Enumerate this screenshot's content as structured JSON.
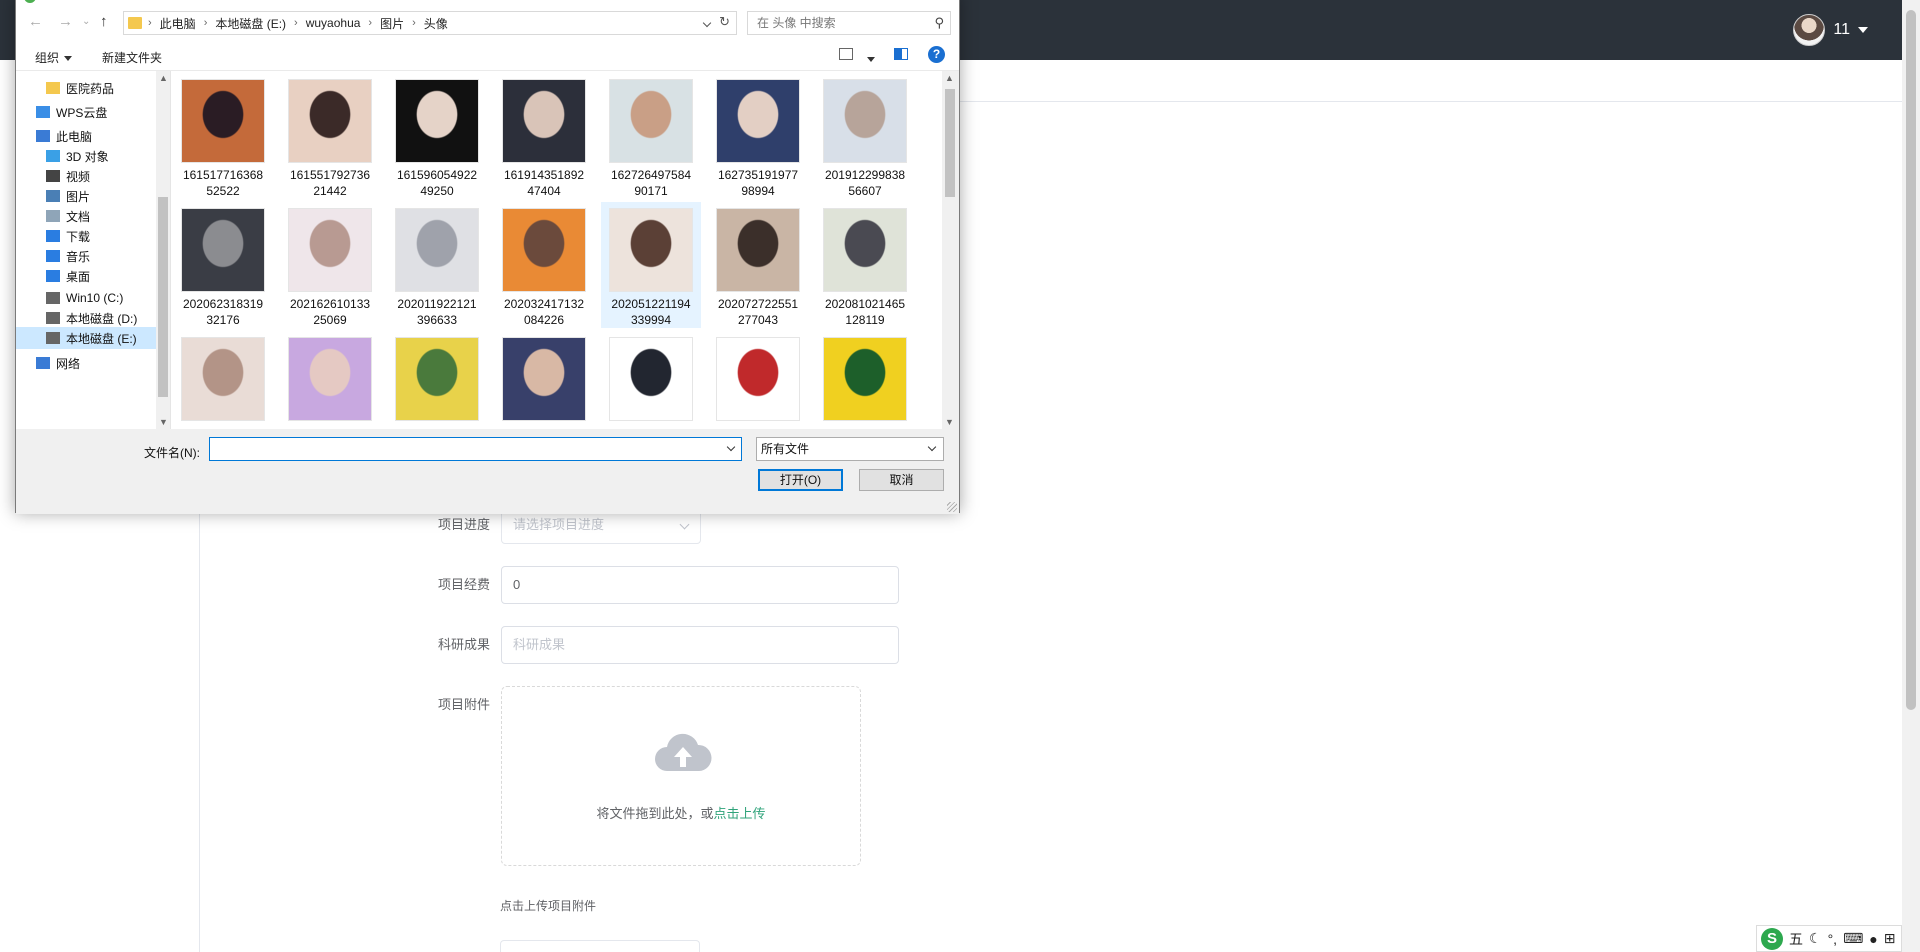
{
  "app": {
    "username": "11"
  },
  "form": {
    "progress_label": "项目进度",
    "progress_placeholder": "请选择项目进度",
    "funding_label": "项目经费",
    "funding_value": "0",
    "results_label": "科研成果",
    "results_placeholder": "科研成果",
    "attachment_label": "项目附件",
    "upload_text": "将文件拖到此处，或",
    "upload_link": "点击上传",
    "upload_tip": "点击上传项目附件"
  },
  "ime": {
    "logo": "S",
    "mode": "五",
    "icons": [
      "moon-icon",
      "punctuation-icon",
      "keyboard-icon",
      "user-icon",
      "grid-icon"
    ]
  },
  "dialog": {
    "breadcrumb": [
      "此电脑",
      "本地磁盘 (E:)",
      "wuyaohua",
      "图片",
      "头像"
    ],
    "search_placeholder": "在 头像 中搜索",
    "organize_label": "组织",
    "new_folder_label": "新建文件夹",
    "help_label": "?",
    "nav_items": [
      {
        "label": "医院药品",
        "icon": "folder-icon",
        "color": "#f4c84e"
      },
      {
        "label": "WPS云盘",
        "icon": "cloud-icon",
        "color": "#3a8ee6"
      },
      {
        "label": "此电脑",
        "icon": "computer-icon",
        "color": "#3a7bd5"
      },
      {
        "label": "3D 对象",
        "icon": "cube-icon",
        "color": "#3aa0e6"
      },
      {
        "label": "视频",
        "icon": "video-icon",
        "color": "#444444"
      },
      {
        "label": "图片",
        "icon": "picture-icon",
        "color": "#4a7fb5"
      },
      {
        "label": "文档",
        "icon": "document-icon",
        "color": "#8fa5b8"
      },
      {
        "label": "下载",
        "icon": "download-icon",
        "color": "#2a7de1"
      },
      {
        "label": "音乐",
        "icon": "music-icon",
        "color": "#2a7de1"
      },
      {
        "label": "桌面",
        "icon": "desktop-icon",
        "color": "#2a7de1"
      },
      {
        "label": "Win10 (C:)",
        "icon": "drive-icon",
        "color": "#666666"
      },
      {
        "label": "本地磁盘 (D:)",
        "icon": "drive-icon",
        "color": "#666666"
      },
      {
        "label": "本地磁盘 (E:)",
        "icon": "drive-icon",
        "color": "#666666"
      },
      {
        "label": "网络",
        "icon": "network-icon",
        "color": "#3a7bd5"
      }
    ],
    "files": [
      {
        "name": "161517716368 52522",
        "c1": "#c46a3a",
        "c2": "#2a1c24"
      },
      {
        "name": "161551792736 21442",
        "c1": "#e8d0c2",
        "c2": "#3b2a28"
      },
      {
        "name": "161596054922 49250",
        "c1": "#111111",
        "c2": "#e5d3c8"
      },
      {
        "name": "161914351892 47404",
        "c1": "#2c2f3a",
        "c2": "#d9c4b8"
      },
      {
        "name": "162726497584 90171",
        "c1": "#d8e1e4",
        "c2": "#c99f86"
      },
      {
        "name": "162735191977 98994",
        "c1": "#2f3f6b",
        "c2": "#e3cfc4"
      },
      {
        "name": "201912299838 56607",
        "c1": "#d8dfe8",
        "c2": "#b7a49a"
      },
      {
        "name": "202062318319 32176",
        "c1": "#3a3d45",
        "c2": "#8b8c90"
      },
      {
        "name": "202162610133 25069",
        "c1": "#efe6ea",
        "c2": "#b89a92"
      },
      {
        "name": "202011922121 396633",
        "c1": "#dfe0e4",
        "c2": "#9fa2ab"
      },
      {
        "name": "202032417132 084226",
        "c1": "#e98a35",
        "c2": "#6b4a3c"
      },
      {
        "name": "202051221194 339994",
        "c1": "#ede3dc",
        "c2": "#5b4036"
      },
      {
        "name": "202072722551 277043",
        "c1": "#c9b5a5",
        "c2": "#3b2f2a"
      },
      {
        "name": "202081021465 128119",
        "c1": "#dfe3d8",
        "c2": "#4a4a52"
      },
      {
        "name": "",
        "c1": "#e9dcd6",
        "c2": "#b39487"
      },
      {
        "name": "",
        "c1": "#c8a8e0",
        "c2": "#e5c9c3"
      },
      {
        "name": "",
        "c1": "#e8d24a",
        "c2": "#4a7a3c"
      },
      {
        "name": "",
        "c1": "#38406a",
        "c2": "#d8b8a5"
      },
      {
        "name": "",
        "c1": "#ffffff",
        "c2": "#222630"
      },
      {
        "name": "",
        "c1": "#ffffff",
        "c2": "#c0292b"
      },
      {
        "name": "",
        "c1": "#f0d020",
        "c2": "#1d5f2a"
      }
    ],
    "filename_label": "文件名(N):",
    "filename_value": "",
    "filetype_value": "所有文件",
    "open_label": "打开(O)",
    "cancel_label": "取消"
  }
}
